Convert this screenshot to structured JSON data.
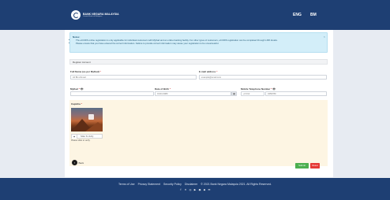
{
  "header": {
    "logo_title": "BANK NEGARA MALAYSIA",
    "logo_subtitle": "Central Bank of Malaysia",
    "lang_eng": "ENG",
    "lang_bm": "BM"
  },
  "notes": {
    "title": "Notes:",
    "items": [
      "The eCCRIS online registration is only applicable for individual customers with MyKad and an online banking facility. For other types of customers, eCCRIS registration can be completed through LINK kiosks.",
      "Please ensure that you have entered the correct information. Failure to provide correct information may cause your registration to be unsuccessful."
    ],
    "close_label": "×"
  },
  "register": {
    "section_title": "Register Account",
    "full_name_label": "Full Name (as per MyKad)",
    "full_name_value": "Ali Bin Ahmad",
    "email_label": "E-mail address",
    "email_value": "example@email.com",
    "mykad_label": "MyKad",
    "mykad_value": "",
    "dob_label": "Date of Birth",
    "dob_value": "01/01/1980",
    "phone_label": "Mobile Telephone Number",
    "phone_prefix": "+6  012",
    "phone_value": "3456789",
    "required_mark": "*",
    "eye_icon_glyph": "👁"
  },
  "captcha": {
    "label": "Captcha",
    "slider_text": "Slide To Verify",
    "slider_knob": "+",
    "hint": "Please slide to verify."
  },
  "actions": {
    "back_label": "Back",
    "submit_label": "Submit",
    "reset_label": "Reset"
  },
  "footer": {
    "links": [
      "Terms of Use",
      "Privacy Statement",
      "Security Policy",
      "Disclaimer"
    ],
    "copyright": "© 2021 Bank Negara Malaysia 2021. All Rights Reserved.",
    "social_icons": [
      "f",
      "t",
      "ig",
      "yt",
      "rss",
      "p",
      "mail"
    ],
    "social_glyphs": [
      "f",
      "✕",
      "◎",
      "▶",
      "◉",
      "◆",
      "✉"
    ]
  },
  "colors": {
    "brand_navy": "#1e3f73",
    "notes_bg": "#d3eef9",
    "captcha_bg": "#fdf5e3",
    "submit": "#4caf50",
    "reset": "#e53935"
  }
}
